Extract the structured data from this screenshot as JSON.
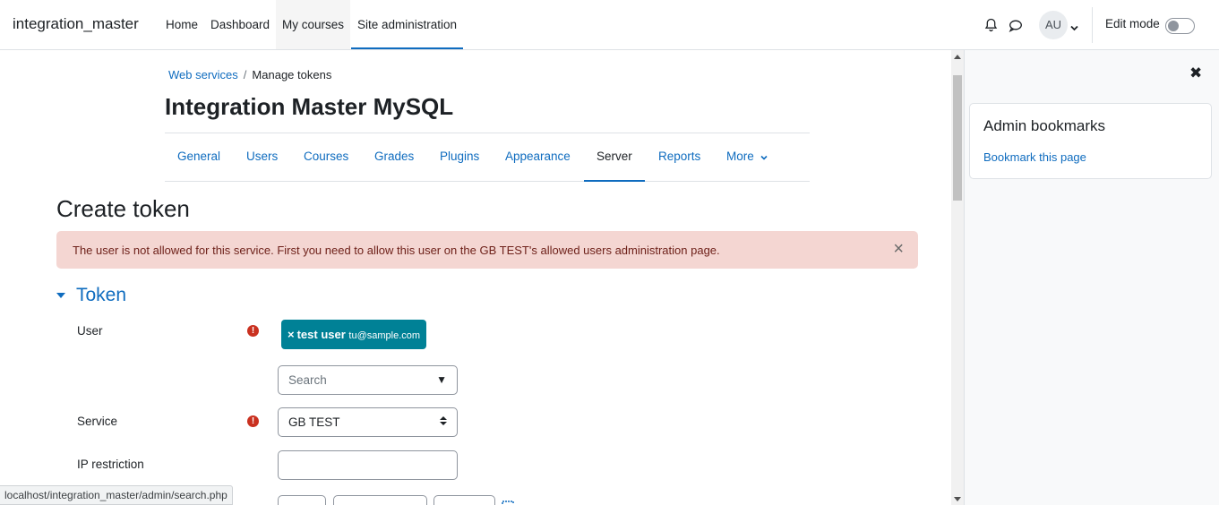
{
  "navbar": {
    "brand": "integration_master",
    "links": [
      "Home",
      "Dashboard",
      "My courses",
      "Site administration"
    ],
    "avatar_initials": "AU",
    "edit_mode_label": "Edit mode",
    "edit_mode_on": false
  },
  "breadcrumb": [
    "Web services",
    "Manage tokens"
  ],
  "page_heading": "Integration Master MySQL",
  "secondary_nav": [
    "General",
    "Users",
    "Courses",
    "Grades",
    "Plugins",
    "Appearance",
    "Server",
    "Reports",
    "More"
  ],
  "secondary_nav_active": "Server",
  "form": {
    "heading": "Create token",
    "alert": "The user is not allowed for this service. First you need to allow this user on the GB TEST's allowed users administration page.",
    "section_title": "Token",
    "user_label": "User",
    "selected_user": {
      "name": "test user",
      "email": "tu@sample.com"
    },
    "search_placeholder": "Search",
    "service_label": "Service",
    "service_value": "GB TEST",
    "ip_label": "IP restriction",
    "ip_value": ""
  },
  "statusbar_url": "localhost/integration_master/admin/search.php",
  "drawer": {
    "block_title": "Admin bookmarks",
    "block_link": "Bookmark this page"
  },
  "colors": {
    "link": "#0f6cbf",
    "alert_bg": "#f4d6d2",
    "alert_text": "#6e211a",
    "chip_bg": "#008196",
    "required": "#ca3120"
  }
}
